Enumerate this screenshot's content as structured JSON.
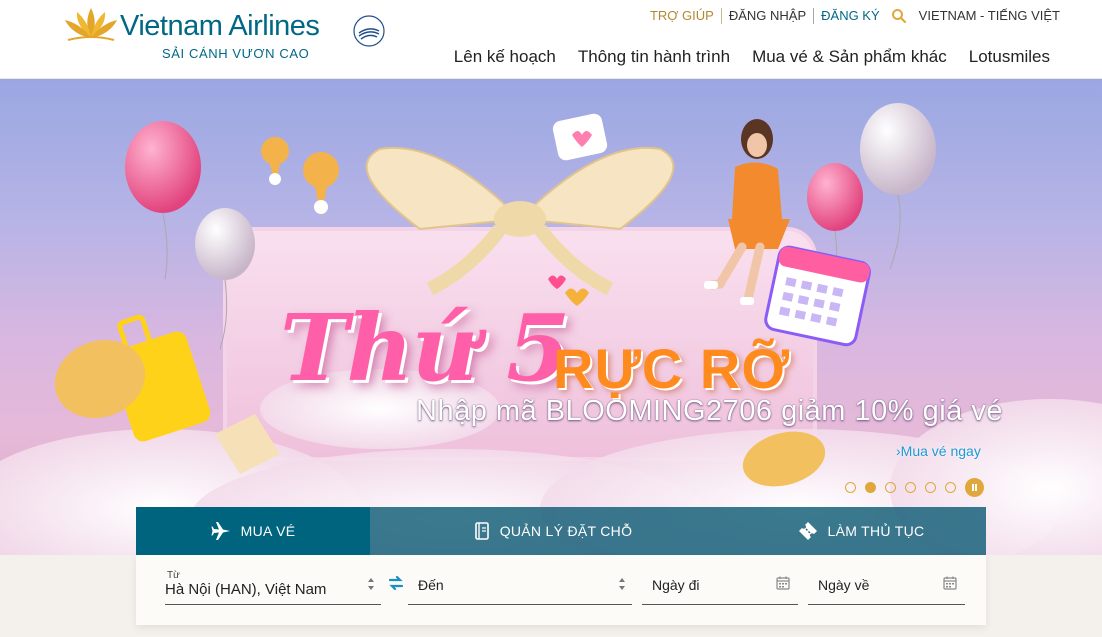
{
  "brand": {
    "name": "Vietnam Airlines",
    "tagline": "SẢI CÁNH VƯƠN CAO",
    "alliance": "SKYTEAM",
    "primary_color": "#006885",
    "gold_color": "#e0a83a"
  },
  "toplinks": {
    "help": "TRỢ GIÚP",
    "login": "ĐĂNG NHẬP",
    "register": "ĐĂNG KÝ",
    "language": "VIETNAM - TIẾNG VIỆT"
  },
  "nav": [
    "Lên kế hoạch",
    "Thông tin hành trình",
    "Mua vé & Sản phẩm khác",
    "Lotusmiles"
  ],
  "hero": {
    "title": "Thứ 5",
    "subtitle": "RỰC RỠ",
    "promo": "Nhập mã BLOOMING2706 giảm 10% giá vé",
    "cta": "Mua vé ngay",
    "slide_count": 6,
    "active_slide": 2
  },
  "tabs": [
    {
      "label": "MUA VÉ",
      "icon": "plane-icon"
    },
    {
      "label": "QUẢN LÝ ĐẶT CHỖ",
      "icon": "booklet-icon"
    },
    {
      "label": "LÀM THỦ TỤC",
      "icon": "ticket-icon"
    }
  ],
  "booking": {
    "from_label": "Từ",
    "from_value": "Hà Nội (HAN), Việt Nam",
    "to_placeholder": "Đến",
    "depart_placeholder": "Ngày đi",
    "return_placeholder": "Ngày về"
  }
}
